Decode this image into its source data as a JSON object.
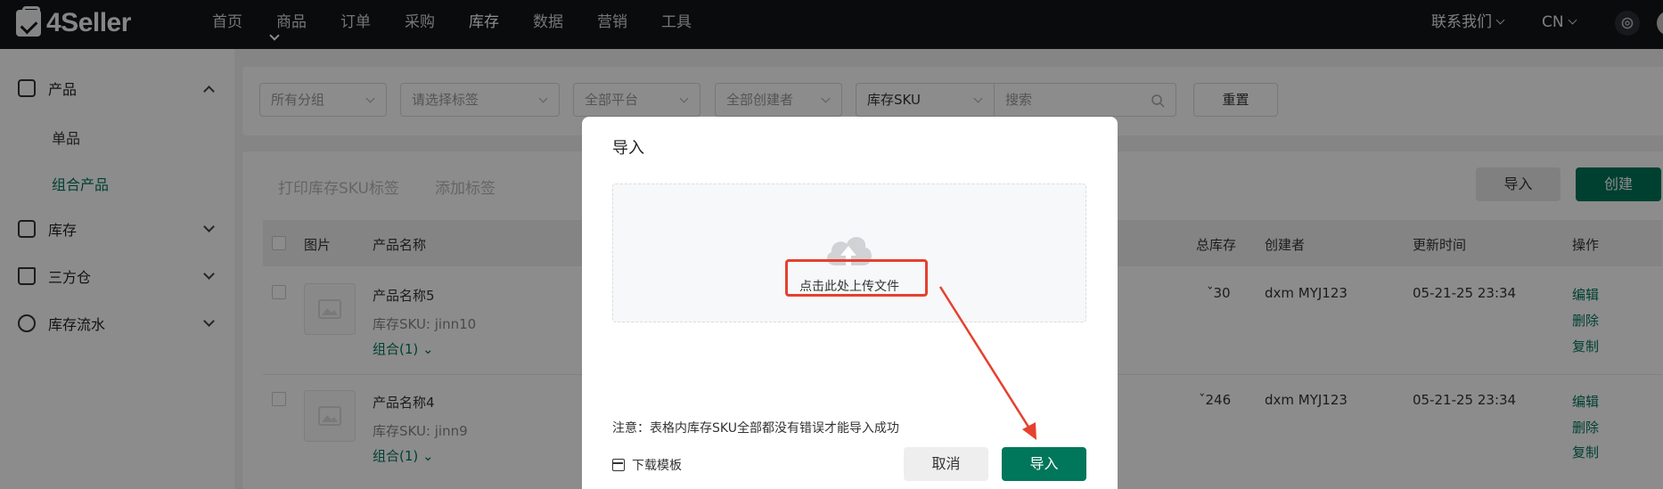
{
  "brand": {
    "logo_text": "4Seller"
  },
  "nav": {
    "items": [
      "首页",
      "商品",
      "订单",
      "采购",
      "库存",
      "数据",
      "营销",
      "工具"
    ],
    "active": "库存"
  },
  "top_right": {
    "contact": "联系我们",
    "lang": "CN"
  },
  "sidebar": {
    "product": "产品",
    "single": "单品",
    "combo": "组合产品",
    "inventory": "库存",
    "third_party": "三方仓",
    "flow": "库存流水"
  },
  "filters": {
    "group": "所有分组",
    "tags": "请选择标签",
    "platform": "全部平台",
    "creator": "全部创建者",
    "sku_type": "库存SKU",
    "search_placeholder": "搜索",
    "reset": "重置"
  },
  "toolbar": {
    "print": "打印库存SKU标签",
    "add_tag": "添加标签",
    "import": "导入",
    "create": "创建"
  },
  "table": {
    "headers": {
      "image": "图片",
      "name": "产品名称",
      "total": "总库存",
      "creator": "创建者",
      "updated": "更新时间",
      "ops": "操作"
    },
    "rows": [
      {
        "name": "产品名称5",
        "sku": "库存SKU: jinn10",
        "combo": "组合(1)",
        "total": "30",
        "creator": "dxm MYJ123",
        "updated": "05-21-25 23:34"
      },
      {
        "name": "产品名称4",
        "sku": "库存SKU: jinn9",
        "combo": "组合(1)",
        "total": "246",
        "creator": "dxm MYJ123",
        "updated": "05-21-25 23:34"
      }
    ],
    "ops": {
      "edit": "编辑",
      "delete": "删除",
      "copy": "复制"
    }
  },
  "modal": {
    "title": "导入",
    "upload_text": "点击此处上传文件",
    "notice": "注意：表格内库存SKU全部都没有错误才能导入成功",
    "download": "下载模板",
    "cancel": "取消",
    "ok": "导入"
  },
  "colors": {
    "brand_green": "#00765a",
    "topbar": "#111418",
    "annotation_red": "#e5412f"
  }
}
